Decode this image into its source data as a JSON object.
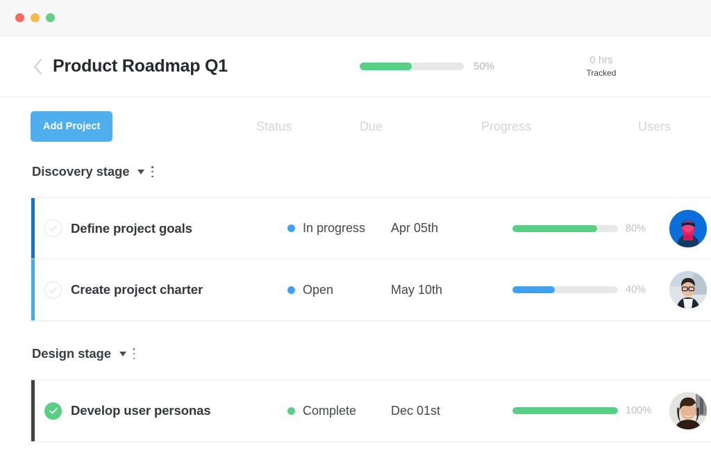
{
  "window": {
    "traffic_lights": [
      {
        "name": "close",
        "color": "#f26c61"
      },
      {
        "name": "minimize",
        "color": "#f3bb4d"
      },
      {
        "name": "maximize",
        "color": "#64cf85"
      }
    ]
  },
  "header": {
    "back_icon": "chevron-left-icon",
    "title": "Product Roadmap Q1",
    "progress": {
      "percent": 50,
      "percent_label": "50%",
      "fill_color": "#58ce87",
      "track_color": "#e8e8e8"
    },
    "tracked": {
      "value": "0 hrs",
      "label": "Tracked"
    }
  },
  "toolbar": {
    "add_project_label": "Add Project",
    "add_project_color": "#4fafee",
    "columns": [
      {
        "key": "status",
        "label": "Status"
      },
      {
        "key": "due",
        "label": "Due"
      },
      {
        "key": "progress",
        "label": "Progress"
      },
      {
        "key": "users",
        "label": "Users"
      }
    ]
  },
  "stages": [
    {
      "title": "Discovery stage",
      "caret_icon": "caret-down-icon",
      "menu_icon": "kebab-menu-icon",
      "tasks": [
        {
          "name": "Define project goals",
          "checked": false,
          "check_icon": "circle-check-outline-icon",
          "accent_color": "#1b6fd6",
          "status": "In progress",
          "status_color": "#3fa0f0",
          "due": "Apr 05th",
          "progress_percent": 80,
          "progress_label": "80%",
          "progress_color": "#58ce87",
          "avatar": "avatar-blue-portrait"
        },
        {
          "name": "Create project charter",
          "checked": false,
          "check_icon": "circle-check-outline-icon",
          "accent_color": "#4aa7f2",
          "status": "Open",
          "status_color": "#3fa0f0",
          "due": "May 10th",
          "progress_percent": 40,
          "progress_label": "40%",
          "progress_color": "#3fa0f0",
          "avatar": "avatar-man-glasses"
        }
      ]
    },
    {
      "title": "Design stage",
      "caret_icon": "caret-down-icon",
      "menu_icon": "kebab-menu-icon",
      "tasks": [
        {
          "name": "Develop user personas",
          "checked": true,
          "check_icon": "circle-check-filled-icon",
          "accent_color": "#404447",
          "status": "Complete",
          "status_color": "#5ace86",
          "due": "Dec 01st",
          "progress_percent": 100,
          "progress_label": "100%",
          "progress_color": "#58ce87",
          "avatar": "avatar-woman-dark-hair"
        }
      ]
    }
  ]
}
